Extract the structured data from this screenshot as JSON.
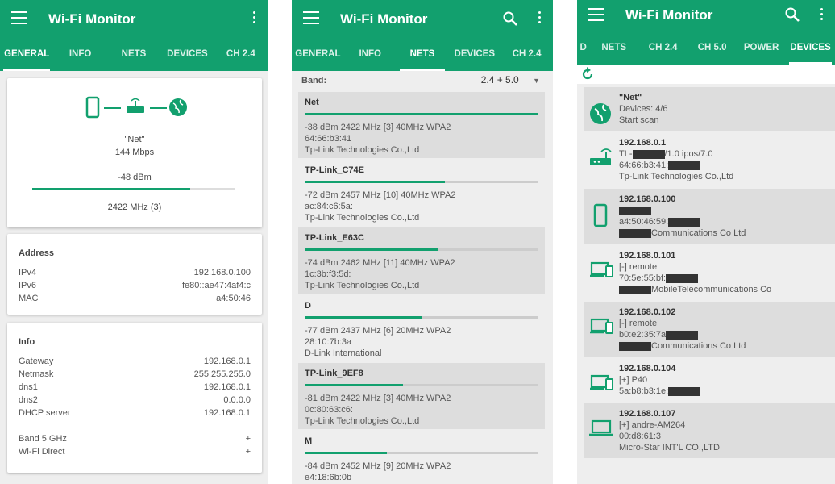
{
  "colors": {
    "accent": "#12a06e",
    "background": "#eeeeee"
  },
  "app_title": "Wi-Fi Monitor",
  "screen1": {
    "tabs": [
      "GENERAL",
      "INFO",
      "NETS",
      "DEVICES",
      "CH 2.4"
    ],
    "active_tab": "GENERAL",
    "connection": {
      "ssid": "\"Net\"",
      "speed": "144 Mbps",
      "signal": "-48 dBm",
      "signal_fraction": 0.78,
      "frequency": "2422 MHz (3)"
    },
    "address": {
      "header": "Address",
      "rows": [
        {
          "label": "IPv4",
          "value": "192.168.0.100"
        },
        {
          "label": "IPv6",
          "value": "fe80::ae47:4af4:c"
        },
        {
          "label": "MAC",
          "value": "a4:50:46"
        }
      ]
    },
    "info": {
      "header": "Info",
      "rows": [
        {
          "label": "Gateway",
          "value": "192.168.0.1"
        },
        {
          "label": "Netmask",
          "value": "255.255.255.0"
        },
        {
          "label": "dns1",
          "value": "192.168.0.1"
        },
        {
          "label": "dns2",
          "value": "0.0.0.0"
        },
        {
          "label": "DHCP server",
          "value": "192.168.0.1"
        }
      ],
      "expanders": [
        {
          "label": "Band 5 GHz",
          "value": "+"
        },
        {
          "label": "Wi-Fi Direct",
          "value": "+"
        }
      ]
    }
  },
  "screen2": {
    "tabs": [
      "GENERAL",
      "INFO",
      "NETS",
      "DEVICES",
      "CH 2.4"
    ],
    "active_tab": "NETS",
    "band_label": "Band:",
    "band_value": "2.4 + 5.0",
    "networks": [
      {
        "name": "Net",
        "line1": "-38 dBm 2422 MHz [3] 40MHz WPA2",
        "line2": "64:66:b3:41",
        "line3": "Tp-Link Technologies Co.,Ltd",
        "strength": 1.0
      },
      {
        "name": "TP-Link_C74E",
        "line1": "-72 dBm 2457 MHz [10] 40MHz WPA2",
        "line2": "ac:84:c6:5a:",
        "line3": "Tp-Link Technologies Co.,Ltd",
        "strength": 0.6
      },
      {
        "name": "TP-Link_E63C",
        "line1": "-74 dBm 2462 MHz [11] 40MHz WPA2",
        "line2": "1c:3b:f3:5d:",
        "line3": "Tp-Link Technologies Co.,Ltd",
        "strength": 0.57
      },
      {
        "name": "D",
        "line1": "-77 dBm 2437 MHz [6] 20MHz WPA2",
        "line2": "28:10:7b:3a",
        "line3": "D-Link International",
        "strength": 0.5
      },
      {
        "name": "TP-Link_9EF8",
        "line1": "-81 dBm 2422 MHz [3] 40MHz WPA2",
        "line2": "0c:80:63:c6:",
        "line3": "Tp-Link Technologies Co.,Ltd",
        "strength": 0.42
      },
      {
        "name": "M",
        "line1": "-84 dBm 2452 MHz [9] 20MHz WPA2",
        "line2": "e4:18:6b:0b",
        "line3": "",
        "strength": 0.35
      }
    ]
  },
  "screen3": {
    "tabs": [
      "D",
      "NETS",
      "CH 2.4",
      "CH 5.0",
      "POWER",
      "DEVICES"
    ],
    "active_tab": "DEVICES",
    "devices": [
      {
        "icon": "globe-icon",
        "title": "\"Net\"",
        "lines": [
          "Devices: 4/6",
          "Start scan"
        ]
      },
      {
        "icon": "router-icon",
        "title": "192.168.0.1",
        "lines": [
          "TL-|/1.0 ipos/7.0",
          "64:66:b3:41:|",
          "Tp-Link Technologies Co.,Ltd"
        ]
      },
      {
        "icon": "phone-icon",
        "title": "192.168.0.100",
        "lines": [
          "|",
          "a4:50:46:59:|",
          "|Communications Co Ltd"
        ]
      },
      {
        "icon": "devices-icon",
        "title": "192.168.0.101",
        "lines": [
          "[-] remote",
          "70:5e:55:bf:|",
          "|MobileTelecommunications Co"
        ]
      },
      {
        "icon": "devices-icon",
        "title": "192.168.0.102",
        "lines": [
          "[-] remote",
          "b0:e2:35:7a|",
          "|Communications Co Ltd"
        ]
      },
      {
        "icon": "devices-icon",
        "title": "192.168.0.104",
        "lines": [
          "[+] P40",
          "5a:b8:b3:1e:|"
        ]
      },
      {
        "icon": "laptop-icon",
        "title": "192.168.0.107",
        "lines": [
          "[+] andre-AM264",
          "00:d8:61:3",
          "Micro-Star INT'L CO.,LTD"
        ]
      }
    ]
  }
}
